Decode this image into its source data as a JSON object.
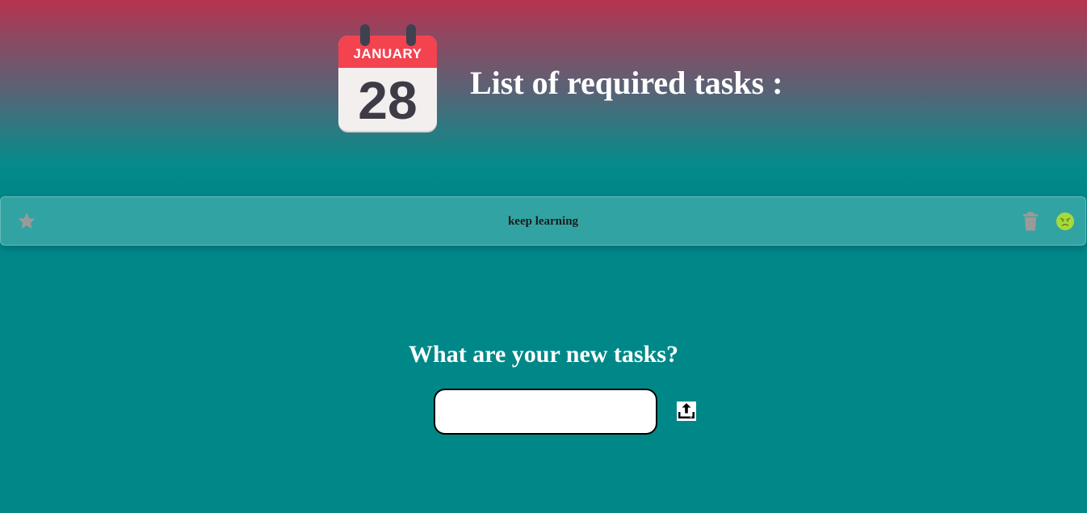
{
  "header": {
    "calendar": {
      "month": "JANUARY",
      "day": "28",
      "colors": {
        "header": "#f2434f",
        "body": "#f3efef",
        "digits": "#3e3b47"
      }
    },
    "title": "List of required tasks :"
  },
  "tasks": [
    {
      "text": "keep learning",
      "starred": false,
      "icons": {
        "star": "star-icon",
        "delete": "trash-icon",
        "mood": "angry-face-icon"
      }
    }
  ],
  "new_task": {
    "prompt": "What are your new tasks?",
    "input_value": "",
    "placeholder": "",
    "submit_icon": "upload-icon"
  },
  "colors": {
    "background_top": "#b7334f",
    "background_main": "#008888",
    "text": "#ffffff",
    "mood_face": "#a6d93b"
  }
}
